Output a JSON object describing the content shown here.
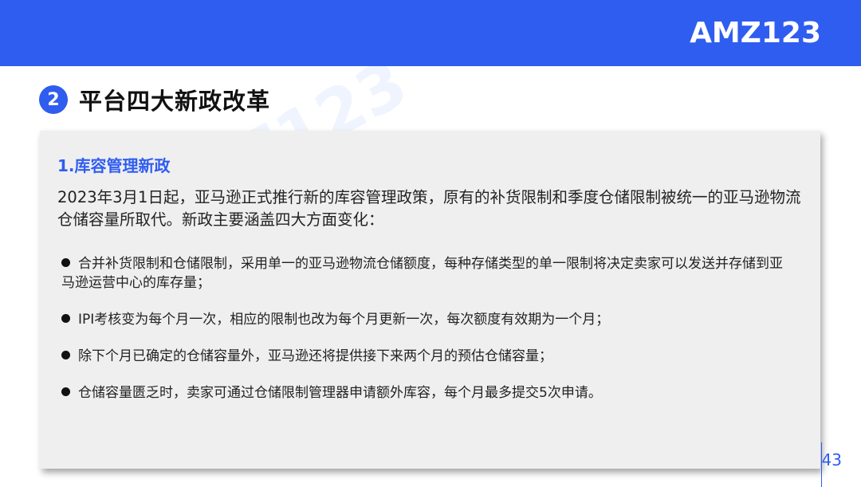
{
  "header": {
    "logo": "AMZ123",
    "color": "#2f5df0"
  },
  "section": {
    "number": "2",
    "title": "平台四大新政改革"
  },
  "card": {
    "subtitle": "1.库容管理新政",
    "intro": "2023年3月1日起，亚马逊正式推行新的库容管理政策，原有的补货限制和季度仓储限制被统一的亚马逊物流仓储容量所取代。新政主要涵盖四大方面变化：",
    "bullets": [
      "合并补货限制和仓储限制，采用单一的亚马逊物流仓储额度，每种存储类型的单一限制将决定卖家可以发送并存储到亚马逊运营中心的库存量；",
      "IPI考核变为每个月一次，相应的限制也改为每个月更新一次，每次额度有效期为一个月；",
      "除下个月已确定的仓储容量外，亚马逊还将提供接下来两个月的预估仓储容量；",
      "仓储容量匮乏时，卖家可通过仓储限制管理器申请额外库容，每个月最多提交5次申请。"
    ]
  },
  "watermark": "AMZ123",
  "page_number": "43"
}
